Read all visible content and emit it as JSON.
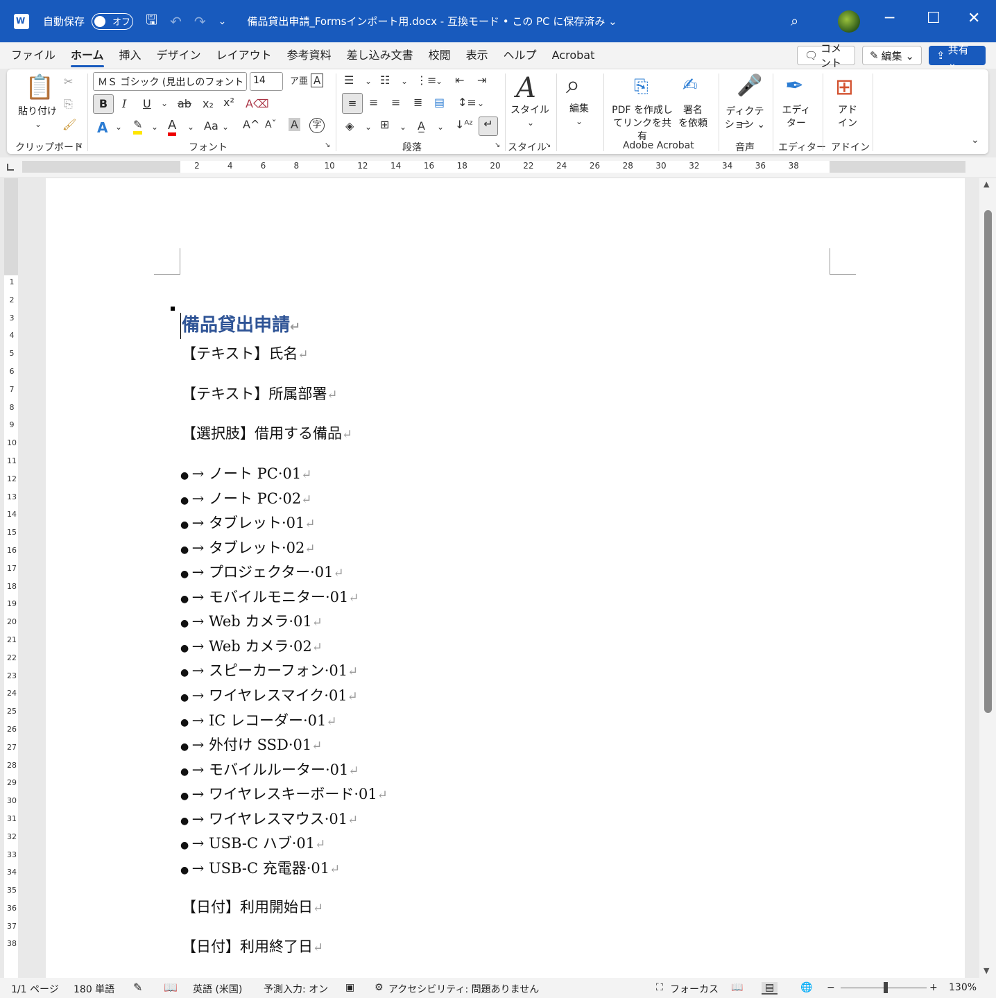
{
  "titlebar": {
    "autosave_label": "自動保存",
    "autosave_state": "オフ",
    "document_title": "備品貸出申請_Formsインポート用.docx - 互換モード • この PC に保存済み ⌄"
  },
  "menu": {
    "tabs": [
      "ファイル",
      "ホーム",
      "挿入",
      "デザイン",
      "レイアウト",
      "参考資料",
      "差し込み文書",
      "校閲",
      "表示",
      "ヘルプ",
      "Acrobat"
    ],
    "active": "ホーム",
    "comment_btn": "コメント",
    "edit_btn": "編集 ⌄",
    "share_btn": "共有 ⌄"
  },
  "ribbon": {
    "paste_label": "貼り付け",
    "font_name": "ＭＳ ゴシック (見出しのフォント -",
    "font_size": "14",
    "groups": {
      "clipboard": "クリップボード",
      "font": "フォント",
      "paragraph": "段落",
      "style": "スタイル",
      "acrobat": "Adobe Acrobat",
      "voice": "音声",
      "editor": "エディター",
      "addin": "アドイン"
    },
    "style_btn": "スタイル",
    "edit_btn": "編集",
    "pdf_btn_line1": "PDF を作成し",
    "pdf_btn_line2": "てリンクを共有",
    "sign_btn_line1": "署名",
    "sign_btn_line2": "を依頼",
    "dictate_line1": "ディクテー",
    "dictate_line2": "ション ⌄",
    "editor_line1": "エディ",
    "editor_line2": "ター",
    "addin_line1": "アド",
    "addin_line2": "イン"
  },
  "ruler": {
    "numbers": [
      "2",
      "4",
      "6",
      "8",
      "10",
      "12",
      "14",
      "16",
      "18",
      "20",
      "22",
      "24",
      "26",
      "28",
      "30",
      "32",
      "34",
      "36",
      "38"
    ],
    "vnumbers": [
      "1",
      "2",
      "3",
      "4",
      "5",
      "6",
      "7",
      "8",
      "9",
      "10",
      "11",
      "12",
      "13",
      "14",
      "15",
      "16",
      "17",
      "18",
      "19",
      "20",
      "21",
      "22",
      "23",
      "24",
      "25",
      "26",
      "27",
      "28",
      "29",
      "30",
      "31",
      "32",
      "33",
      "34",
      "35",
      "36",
      "37",
      "38"
    ]
  },
  "document": {
    "heading": "備品貸出申請",
    "fields": [
      "【テキスト】氏名",
      "【テキスト】所属部署",
      "【選択肢】借用する備品"
    ],
    "items": [
      "ノート PC·01",
      "ノート PC·02",
      "タブレット·01",
      "タブレット·02",
      "プロジェクター·01",
      "モバイルモニター·01",
      "Web カメラ·01",
      "Web カメラ·02",
      "スピーカーフォン·01",
      "ワイヤレスマイク·01",
      "IC レコーダー·01",
      "外付け SSD·01",
      "モバイルルーター·01",
      "ワイヤレスキーボード·01",
      "ワイヤレスマウス·01",
      "USB-C ハブ·01",
      "USB-C 充電器·01"
    ],
    "date_fields": [
      "【日付】利用開始日",
      "【日付】利用終了日"
    ]
  },
  "status": {
    "page": "1/1 ページ",
    "words": "180 単語",
    "language": "英語 (米国)",
    "predictive": "予測入力: オン",
    "accessibility": "アクセシビリティ: 問題ありません",
    "focus": "フォーカス",
    "zoom": "130%"
  },
  "colors": {
    "titlebar": "#185abd",
    "heading": "#2f5496"
  }
}
